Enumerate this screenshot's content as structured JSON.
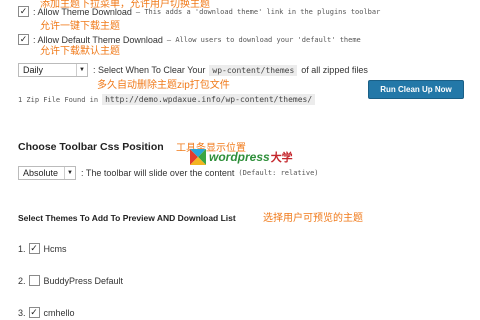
{
  "annotations": {
    "top_cut": "添加主题下拉菜单，允许用户切换主题",
    "allow_download": "允许一键下载主题",
    "allow_default": "允许下载默认主题",
    "auto_delete": "多久自动删除主题zip打包文件",
    "toolbar_position": "工具条显示位置",
    "select_themes": "选择用户可预览的主题"
  },
  "options": {
    "allow_theme_download": {
      "checked": "✓",
      "label": ": Allow Theme Download",
      "desc": "– This adds a 'download theme' link in the plugins toolbar"
    },
    "allow_default_download": {
      "checked": "✓",
      "label": ": Allow Default Theme Download",
      "desc": "– Allow users to download your 'default' theme"
    }
  },
  "cleanup": {
    "frequency": "Daily",
    "text_prefix": ": Select When To Clear Your",
    "path": "wp-content/themes",
    "text_suffix": "of all zipped files",
    "found_prefix": "1 Zip File Found in",
    "found_path": "http://demo.wpdaxue.info/wp-content/themes/",
    "button": "Run Clean Up Now"
  },
  "toolbar": {
    "heading": "Choose Toolbar Css Position",
    "position": "Absolute",
    "desc": ": The toolbar will slide over the content",
    "default_note": "(Default: relative)"
  },
  "watermark": {
    "brand": "wordpress",
    "suffix": "大学"
  },
  "themes": {
    "heading": "Select Themes To Add To Preview AND Download List",
    "items": [
      {
        "num": "1.",
        "name": "Hcms",
        "checked": "✓"
      },
      {
        "num": "2.",
        "name": "BuddyPress Default",
        "checked": ""
      },
      {
        "num": "3.",
        "name": "cmhello",
        "checked": "✓"
      }
    ]
  }
}
